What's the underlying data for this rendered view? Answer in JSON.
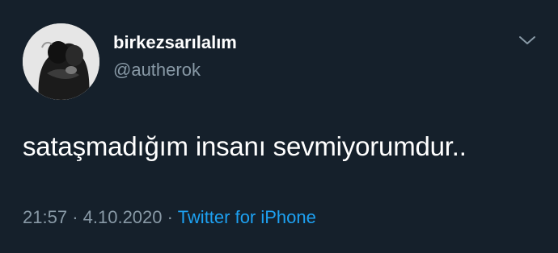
{
  "tweet": {
    "display_name": "birkezsarılalım",
    "handle": "@autherok",
    "text": "sataşmadığım insanı sevmiyorumdur..",
    "time": "21:57",
    "separator": "·",
    "date": "4.10.2020",
    "source": "Twitter for iPhone"
  },
  "icons": {
    "menu": "chevron-down-icon",
    "avatar": "profile-photo"
  },
  "colors": {
    "background": "#15202b",
    "primary_text": "#ffffff",
    "secondary_text": "#8899a6",
    "link": "#1da1f2"
  }
}
